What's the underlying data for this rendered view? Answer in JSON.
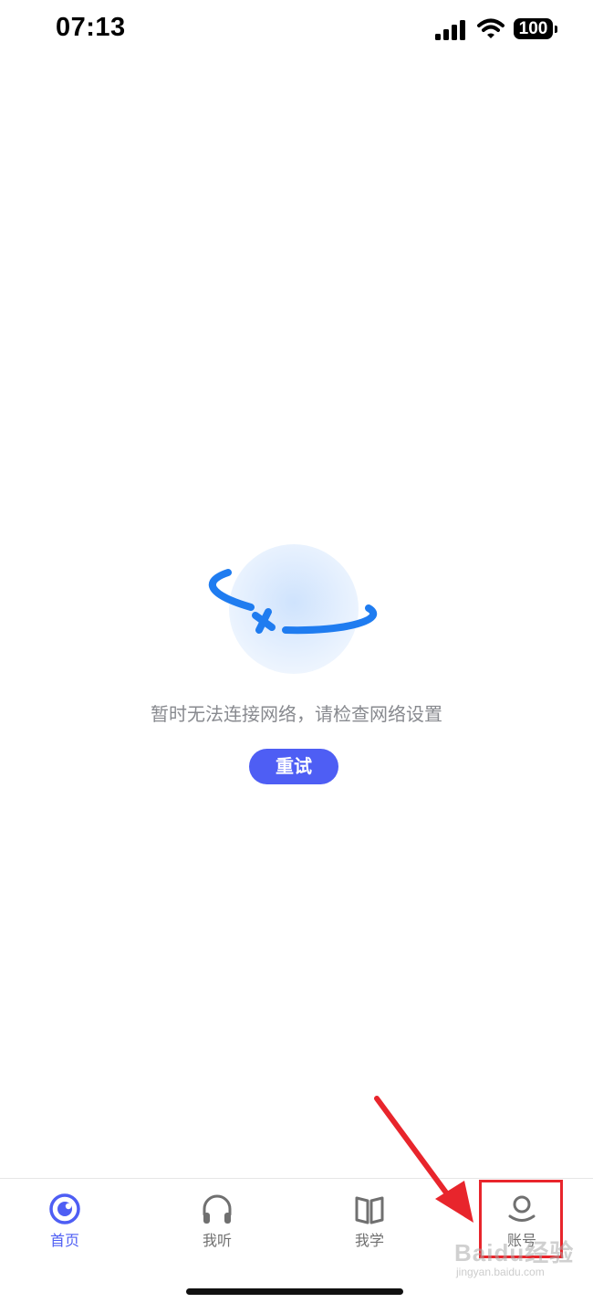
{
  "status_bar": {
    "time": "07:13",
    "battery": "100",
    "icons": [
      "cellular-signal-icon",
      "wifi-icon",
      "battery-icon"
    ]
  },
  "main": {
    "illustration": "network-error-planet-icon",
    "message": "暂时无法连接网络，请检查网络设置",
    "retry_label": "重试"
  },
  "bottom_nav": {
    "items": [
      {
        "label": "首页",
        "icon": "home-icon",
        "active": true
      },
      {
        "label": "我听",
        "icon": "headphones-icon",
        "active": false
      },
      {
        "label": "我学",
        "icon": "book-icon",
        "active": false
      },
      {
        "label": "账号",
        "icon": "account-icon",
        "active": false
      }
    ]
  },
  "watermark": {
    "logo": "Baidu经验",
    "url": "jingyan.baidu.com"
  },
  "colors": {
    "accent": "#4e5ef4",
    "message_text": "#888a8f",
    "nav_inactive": "#707070",
    "annotation": "#e8252c",
    "illustration_blue": "#1f7cf0"
  }
}
